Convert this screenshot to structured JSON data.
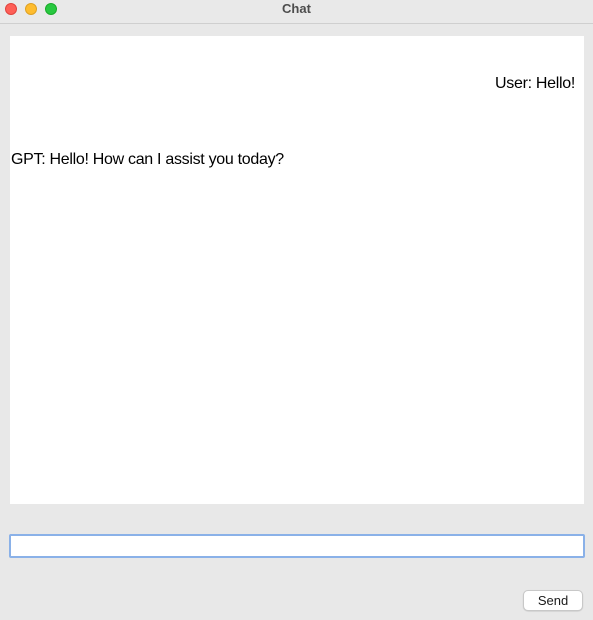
{
  "window": {
    "title": "Chat"
  },
  "chat": {
    "messages": [
      {
        "sender": "user",
        "text": "User: Hello!"
      },
      {
        "sender": "gpt",
        "text": "GPT: Hello! How can I assist you today?"
      }
    ]
  },
  "input": {
    "value": "",
    "placeholder": ""
  },
  "actions": {
    "send_label": "Send"
  },
  "colors": {
    "close": "#fe5f57",
    "minimize": "#febc2e",
    "maximize": "#28c840",
    "focus_ring": "#8ab1e8"
  }
}
